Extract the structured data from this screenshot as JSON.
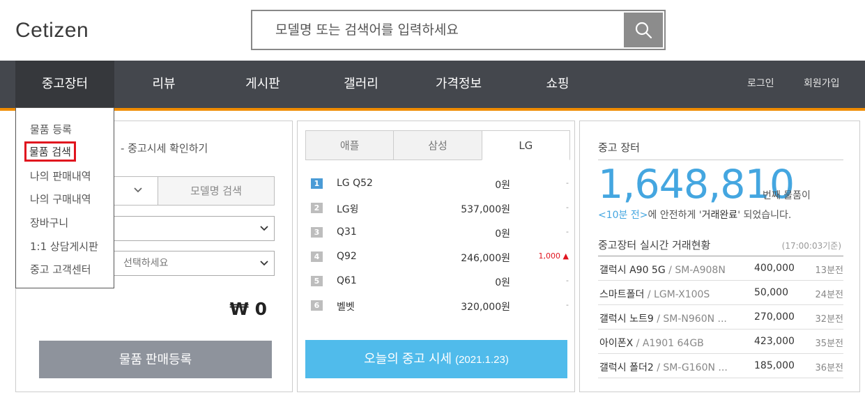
{
  "logo": "Cetizen",
  "search": {
    "placeholder": "모델명 또는 검색어를 입력하세요"
  },
  "nav": {
    "items": [
      "중고장터",
      "리뷰",
      "게시판",
      "갤러리",
      "가격정보",
      "쇼핑"
    ],
    "login": "로그인",
    "signup": "회원가입"
  },
  "dropdown": [
    "물품 등록",
    "물품 검색",
    "나의 판매내역",
    "나의 구매내역",
    "장바구니",
    "1:1 상담게시판",
    "중고 고객센터"
  ],
  "left_panel": {
    "title": "- 중고시세 확인하기",
    "tab_model_search": "모델명 검색",
    "select2_placeholder": "선택하세요",
    "price": "₩ 0",
    "sell_button": "물품 판매등록"
  },
  "mid_panel": {
    "brand_tabs": [
      "애플",
      "삼성",
      "LG"
    ],
    "active_tab": "LG",
    "rankings": [
      {
        "rank": "1",
        "name": "LG Q52",
        "price": "0원",
        "change": "-"
      },
      {
        "rank": "2",
        "name": "LG윙",
        "price": "537,000원",
        "change": "-"
      },
      {
        "rank": "3",
        "name": "Q31",
        "price": "0원",
        "change": "-"
      },
      {
        "rank": "4",
        "name": "Q92",
        "price": "246,000원",
        "change": "1,000 ▲"
      },
      {
        "rank": "5",
        "name": "Q61",
        "price": "0원",
        "change": "-"
      },
      {
        "rank": "6",
        "name": "벨벳",
        "price": "320,000원",
        "change": "-"
      }
    ],
    "today_button": "오늘의 중고 시세",
    "today_date": "(2021.1.23)",
    "up_color": "#e0141e"
  },
  "right_panel": {
    "title": "중고 장터",
    "count": "1,648,810",
    "count_suffix": "번째 물품이",
    "notice_time": "<10분 전>",
    "notice_mid": "에 안전하게 '",
    "notice_bold": "거래완료",
    "notice_end": "' 되었습니다.",
    "live_title": "중고장터 실시간 거래현황",
    "live_time": "(17:00:03기준)",
    "deals": [
      {
        "name": "갤럭시 A90 5G",
        "model": "SM-A908N",
        "price": "400,000",
        "time": "13분전"
      },
      {
        "name": "스마트폴더",
        "model": "LGM-X100S",
        "price": "50,000",
        "time": "24분전"
      },
      {
        "name": "갤럭시 노트9",
        "model": "SM-N960N ...",
        "price": "270,000",
        "time": "32분전"
      },
      {
        "name": "아이폰X",
        "model": "A1901 64GB",
        "price": "423,000",
        "time": "35분전"
      },
      {
        "name": "갤럭시 폴더2",
        "model": "SM-G160N ...",
        "price": "185,000",
        "time": "36분전"
      }
    ],
    "accent": "#44a6e0"
  },
  "colors": {
    "nav_bg": "#44474d",
    "nav_accent": "#f08c00",
    "sell_button": "#8e939c",
    "today_button": "#50bbeb"
  }
}
